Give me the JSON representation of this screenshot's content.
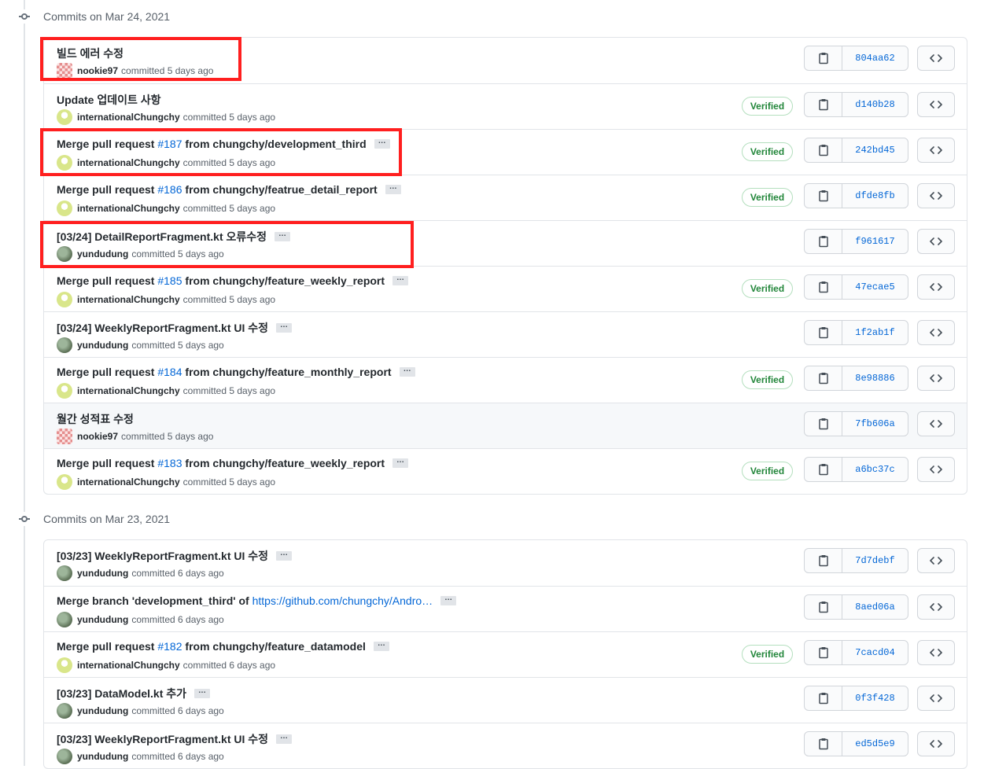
{
  "groups": [
    {
      "title": "Commits on Mar 24, 2021",
      "commits": [
        {
          "parts": [
            {
              "t": "빌드 에러 수정"
            }
          ],
          "ellipsis": false,
          "author": "nookie97",
          "avatar": "nookie",
          "time": "committed 5 days ago",
          "verified": "",
          "sha": "804aa62"
        },
        {
          "parts": [
            {
              "t": "Update 업데이트 사항"
            }
          ],
          "ellipsis": false,
          "author": "internationalChungchy",
          "avatar": "intl",
          "time": "committed 5 days ago",
          "verified": "Verified",
          "sha": "d140b28"
        },
        {
          "parts": [
            {
              "t": "Merge pull request "
            },
            {
              "t": "#187",
              "link": "pr"
            },
            {
              "t": " from chungchy/development_third"
            }
          ],
          "ellipsis": true,
          "author": "internationalChungchy",
          "avatar": "intl",
          "time": "committed 5 days ago",
          "verified": "Verified",
          "sha": "242bd45"
        },
        {
          "parts": [
            {
              "t": "Merge pull request "
            },
            {
              "t": "#186",
              "link": "pr"
            },
            {
              "t": " from chungchy/featrue_detail_report"
            }
          ],
          "ellipsis": true,
          "author": "internationalChungchy",
          "avatar": "intl",
          "time": "committed 5 days ago",
          "verified": "Verified",
          "sha": "dfde8fb"
        },
        {
          "parts": [
            {
              "t": "[03/24] DetailReportFragment.kt 오류수정"
            }
          ],
          "ellipsis": true,
          "author": "yundudung",
          "avatar": "yun",
          "time": "committed 5 days ago",
          "verified": "",
          "sha": "f961617"
        },
        {
          "parts": [
            {
              "t": "Merge pull request "
            },
            {
              "t": "#185",
              "link": "pr"
            },
            {
              "t": " from chungchy/feature_weekly_report"
            }
          ],
          "ellipsis": true,
          "author": "internationalChungchy",
          "avatar": "intl",
          "time": "committed 5 days ago",
          "verified": "Verified",
          "sha": "47ecae5"
        },
        {
          "parts": [
            {
              "t": "[03/24] WeeklyReportFragment.kt UI 수정"
            }
          ],
          "ellipsis": true,
          "author": "yundudung",
          "avatar": "yun",
          "time": "committed 5 days ago",
          "verified": "",
          "sha": "1f2ab1f"
        },
        {
          "parts": [
            {
              "t": "Merge pull request "
            },
            {
              "t": "#184",
              "link": "pr"
            },
            {
              "t": " from chungchy/feature_monthly_report"
            }
          ],
          "ellipsis": true,
          "author": "internationalChungchy",
          "avatar": "intl",
          "time": "committed 5 days ago",
          "verified": "Verified",
          "sha": "8e98886"
        },
        {
          "parts": [
            {
              "t": "월간 성적표 수정"
            }
          ],
          "ellipsis": false,
          "author": "nookie97",
          "avatar": "nookie",
          "time": "committed 5 days ago",
          "verified": "",
          "sha": "7fb606a",
          "highlight": true
        },
        {
          "parts": [
            {
              "t": "Merge pull request "
            },
            {
              "t": "#183",
              "link": "pr"
            },
            {
              "t": " from chungchy/feature_weekly_report"
            }
          ],
          "ellipsis": true,
          "author": "internationalChungchy",
          "avatar": "intl",
          "time": "committed 5 days ago",
          "verified": "Verified",
          "sha": "a6bc37c"
        }
      ]
    },
    {
      "title": "Commits on Mar 23, 2021",
      "commits": [
        {
          "parts": [
            {
              "t": "[03/23] WeeklyReportFragment.kt UI 수정"
            }
          ],
          "ellipsis": true,
          "author": "yundudung",
          "avatar": "yun",
          "time": "committed 6 days ago",
          "verified": "",
          "sha": "7d7debf"
        },
        {
          "parts": [
            {
              "t": "Merge branch 'development_third' of "
            },
            {
              "t": "https://github.com/chungchy/Andro…",
              "link": "url"
            }
          ],
          "ellipsis": true,
          "author": "yundudung",
          "avatar": "yun",
          "time": "committed 6 days ago",
          "verified": "",
          "sha": "8aed06a"
        },
        {
          "parts": [
            {
              "t": "Merge pull request "
            },
            {
              "t": "#182",
              "link": "pr"
            },
            {
              "t": " from chungchy/feature_datamodel"
            }
          ],
          "ellipsis": true,
          "author": "internationalChungchy",
          "avatar": "intl",
          "time": "committed 6 days ago",
          "verified": "Verified",
          "sha": "7cacd04"
        },
        {
          "parts": [
            {
              "t": "[03/23] DataModel.kt 추가"
            }
          ],
          "ellipsis": true,
          "author": "yundudung",
          "avatar": "yun",
          "time": "committed 6 days ago",
          "verified": "",
          "sha": "0f3f428"
        },
        {
          "parts": [
            {
              "t": "[03/23] WeeklyReportFragment.kt UI 수정"
            }
          ],
          "ellipsis": true,
          "author": "yundudung",
          "avatar": "yun",
          "time": "committed 6 days ago",
          "verified": "",
          "sha": "ed5d5e9"
        }
      ]
    }
  ],
  "ellipsis_label": "…",
  "annotation_color": "#ff1f1f"
}
